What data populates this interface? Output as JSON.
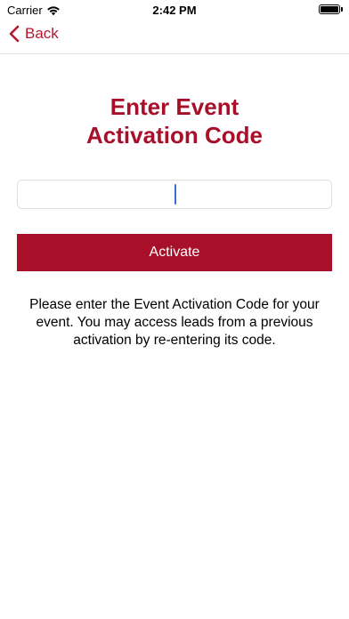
{
  "status_bar": {
    "carrier": "Carrier",
    "time": "2:42 PM",
    "wifi_icon": "wifi-icon",
    "battery_icon": "battery-icon"
  },
  "nav": {
    "back_label": "Back",
    "back_icon": "chevron-left-icon",
    "accent_color": "#b5172f"
  },
  "main": {
    "title": "Enter Event\nActivation Code",
    "code_input_value": "",
    "activate_label": "Activate",
    "instructions": "Please enter the Event Activation Code for your event. You may access leads from a previous activation by re-entering its code.",
    "brand_color": "#a8102a"
  }
}
